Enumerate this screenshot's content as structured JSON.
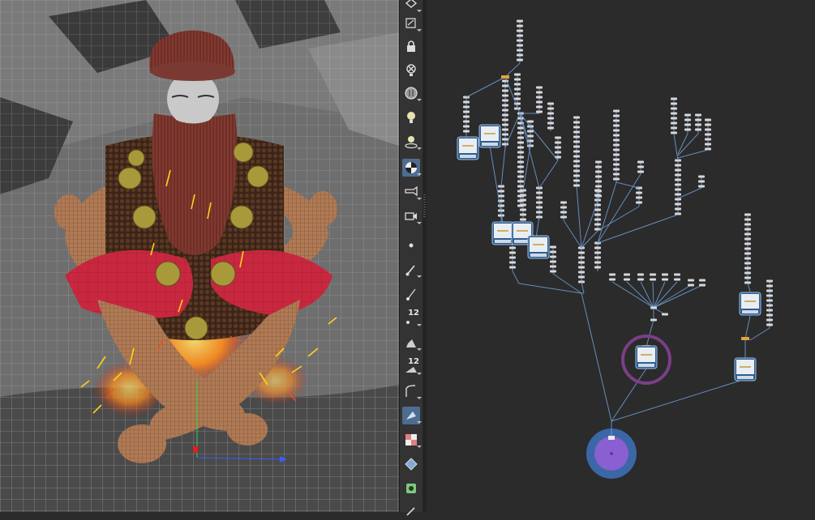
{
  "toolbar": {
    "tools": [
      {
        "name": "display-mode-icon"
      },
      {
        "name": "template-icon"
      },
      {
        "name": "lock-icon"
      },
      {
        "name": "bypass-light-icon"
      },
      {
        "name": "ghost-icon"
      },
      {
        "name": "light-bulb-icon"
      },
      {
        "name": "light-handle-icon"
      },
      {
        "name": "shading-sphere-icon",
        "active": true
      },
      {
        "name": "camera-icon"
      },
      {
        "name": "camera-view-icon"
      },
      {
        "name": "point-icon"
      },
      {
        "name": "brush-icon"
      },
      {
        "name": "pen-icon"
      },
      {
        "name": "point-number-icon",
        "label": "12"
      },
      {
        "name": "paint-icon"
      },
      {
        "name": "primitive-number-icon",
        "label": "12"
      },
      {
        "name": "curve-icon"
      },
      {
        "name": "shaded-plane-icon",
        "active": true
      },
      {
        "name": "texture-checker-icon"
      },
      {
        "name": "display-options-icon"
      },
      {
        "name": "snap-icon"
      },
      {
        "name": "tool-more-icon"
      }
    ]
  },
  "colors": {
    "accent": "#4e6c8f",
    "wire": "#6f9fd8",
    "selection_ring": "#7a3f86",
    "output_node": "#8a5fd1"
  }
}
